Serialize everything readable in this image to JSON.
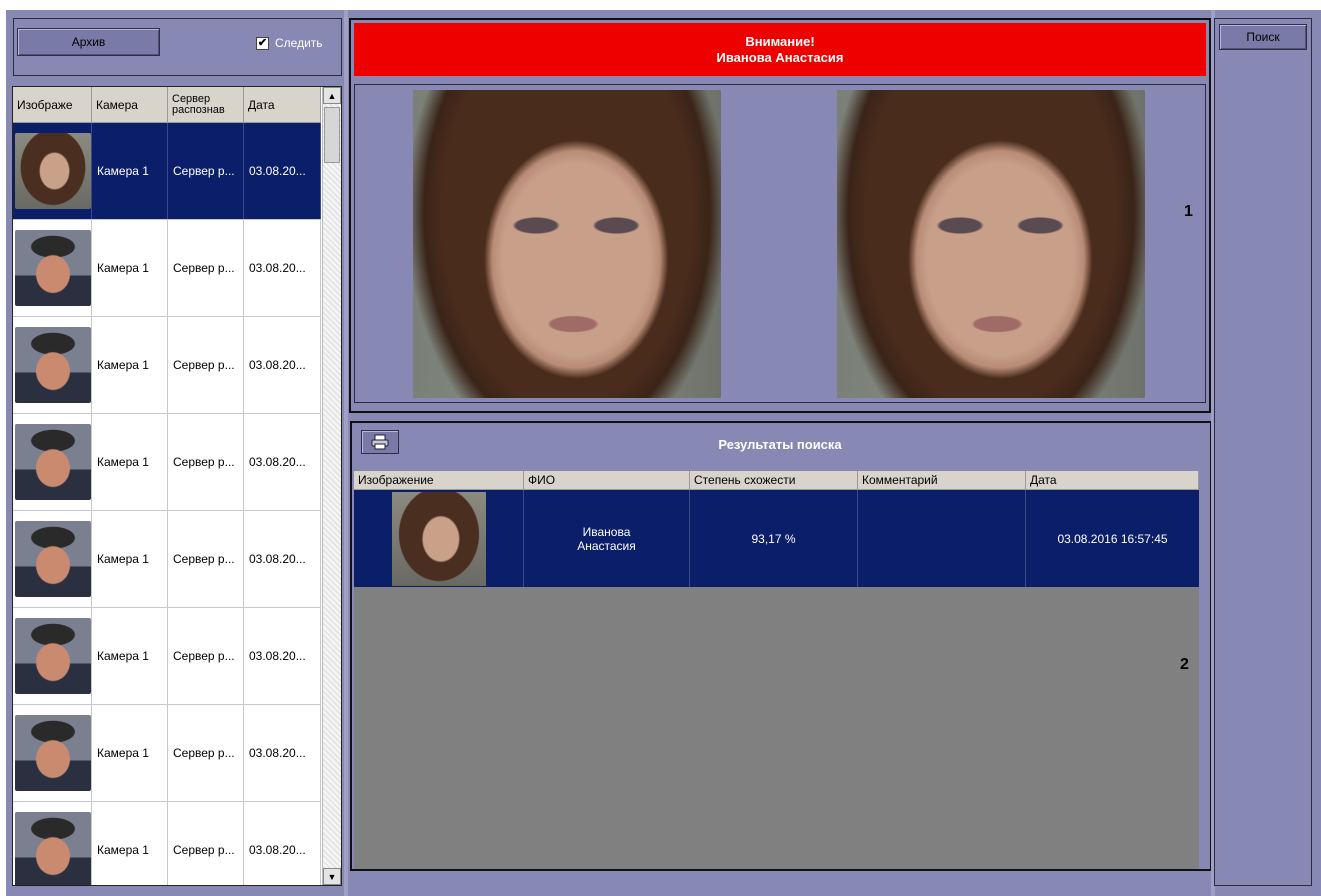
{
  "left_panel": {
    "archive_label": "Архив",
    "follow_label": "Следить",
    "follow_checked": true,
    "columns": [
      "Изображе",
      "Камера",
      "Сервер распознав",
      "Дата"
    ],
    "rows": [
      {
        "camera": "Камера 1",
        "server": "Сервер р...",
        "date": "03.08.20...",
        "selected": true,
        "thumb": "woman"
      },
      {
        "camera": "Камера 1",
        "server": "Сервер р...",
        "date": "03.08.20...",
        "selected": false,
        "thumb": "man"
      },
      {
        "camera": "Камера 1",
        "server": "Сервер р...",
        "date": "03.08.20...",
        "selected": false,
        "thumb": "man"
      },
      {
        "camera": "Камера 1",
        "server": "Сервер р...",
        "date": "03.08.20...",
        "selected": false,
        "thumb": "man"
      },
      {
        "camera": "Камера 1",
        "server": "Сервер р...",
        "date": "03.08.20...",
        "selected": false,
        "thumb": "man"
      },
      {
        "camera": "Камера 1",
        "server": "Сервер р...",
        "date": "03.08.20...",
        "selected": false,
        "thumb": "man"
      },
      {
        "camera": "Камера 1",
        "server": "Сервер р...",
        "date": "03.08.20...",
        "selected": false,
        "thumb": "man"
      },
      {
        "camera": "Камера 1",
        "server": "Сервер р...",
        "date": "03.08.20...",
        "selected": false,
        "thumb": "man"
      }
    ]
  },
  "alert": {
    "line1": "Внимание!",
    "line2": "Иванова Анастасия",
    "color": "#ee0000"
  },
  "markers": {
    "one": "1",
    "two": "2"
  },
  "results": {
    "title": "Результаты поиска",
    "print_icon": "printer-icon",
    "columns": [
      "Изображение",
      "ФИО",
      "Степень схожести",
      "Комментарий",
      "Дата"
    ],
    "row": {
      "fio": "Иванова Анастасия",
      "similarity": "93,17 %",
      "comment": "",
      "date": "03.08.2016 16:57:45"
    }
  },
  "right_panel": {
    "search_label": "Поиск"
  },
  "colors": {
    "background": "#8888b4",
    "selection": "#0a1e6a",
    "grid_empty": "#808080"
  }
}
